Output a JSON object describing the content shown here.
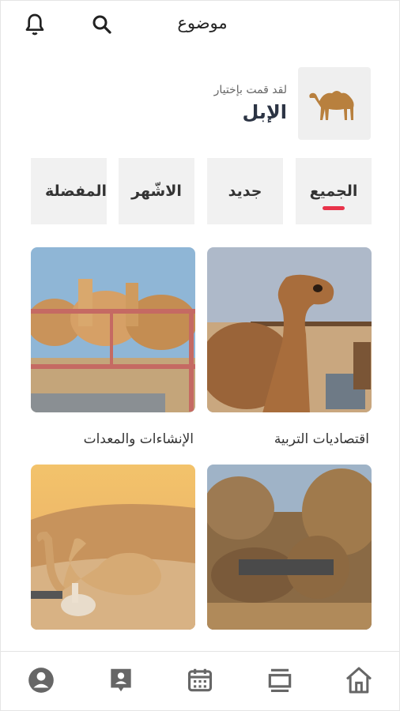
{
  "topbar": {
    "title": "موضوع",
    "icons": [
      "bell-icon",
      "search-icon"
    ]
  },
  "selection": {
    "hint": "لقد قمت بإختيار",
    "name": "الإبل",
    "thumb_icon": "camel-icon"
  },
  "tabs": [
    {
      "label": "الجميع",
      "active": true
    },
    {
      "label": "جديد",
      "active": false
    },
    {
      "label": "الاشّهر",
      "active": false
    },
    {
      "label": "المفضلة",
      "active": false
    }
  ],
  "cards": [
    {
      "label": "اقتصاديات التربية"
    },
    {
      "label": "الإنشاءات والمعدات"
    },
    {
      "label": ""
    },
    {
      "label": ""
    }
  ],
  "bottom_nav": [
    "home-icon",
    "cards-icon",
    "calendar-icon",
    "contact-card-icon",
    "account-icon"
  ],
  "colors": {
    "accent": "#e8334a",
    "icon_gray": "#555555",
    "tab_bg": "#f1f1f1"
  }
}
